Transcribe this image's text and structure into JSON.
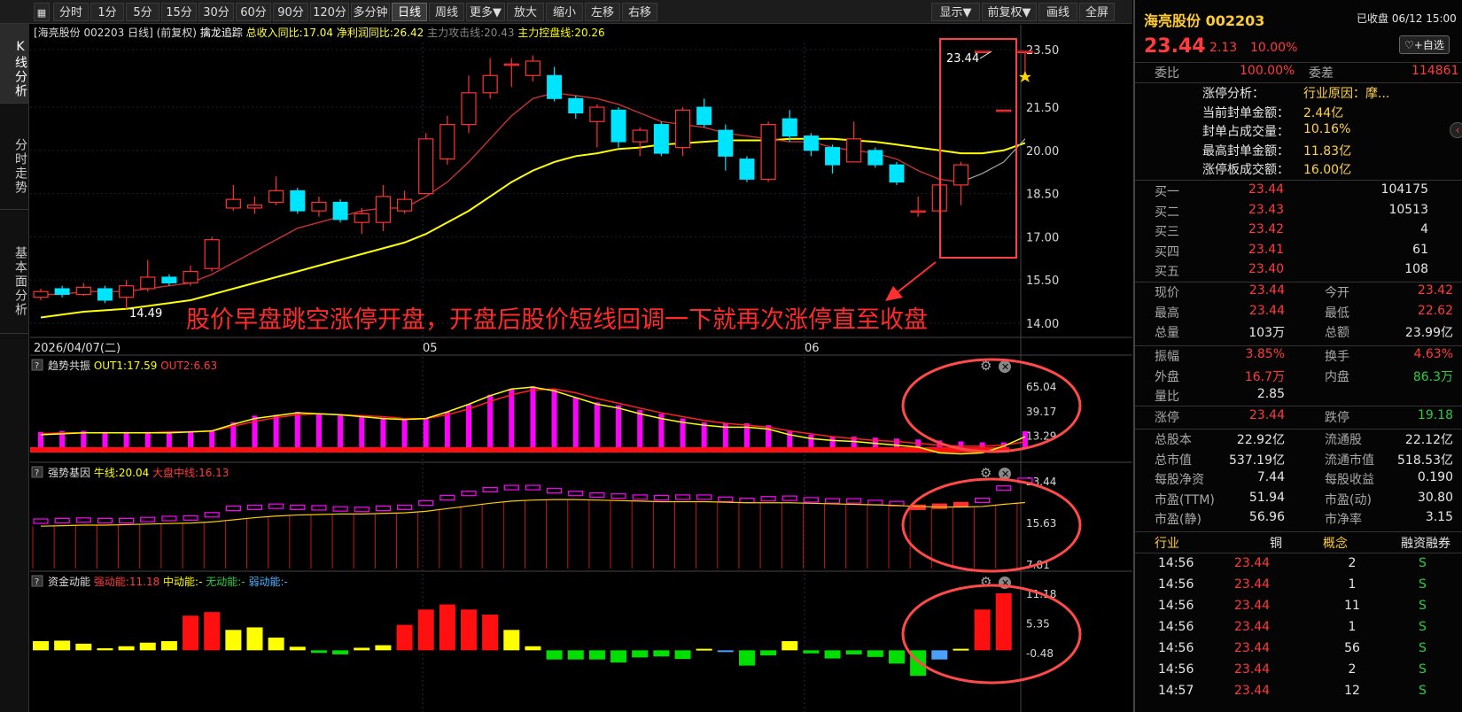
{
  "toolbar": {
    "items": [
      "分时",
      "1分",
      "5分",
      "15分",
      "30分",
      "60分",
      "90分",
      "120分",
      "多分钟",
      "日线",
      "周线",
      "更多▼",
      "放大",
      "缩小",
      "左移",
      "右移"
    ],
    "active": "日线",
    "right_items": [
      "显示▼",
      "前复权▼",
      "画线",
      "全屏"
    ]
  },
  "sidetabs": [
    "K线分析",
    "分时走势",
    "基本面分析"
  ],
  "main_header": {
    "title": "[海亮股份 002203 日线]",
    "adj": "(前复权)",
    "indicator_name": "擒龙追踪",
    "v1": "总收入同比:17.04",
    "v2": "净利润同比:26.42",
    "v3": "主力攻击线:20.43",
    "v4": "主力控盘线:20.26"
  },
  "main_axis": [
    "23.50",
    "21.50",
    "20.00",
    "18.50",
    "17.00",
    "15.50",
    "14.00"
  ],
  "price_label_high": "23.44",
  "price_label_low": "14.49",
  "annotation": "股价早盘跳空涨停开盘，开盘后股价短线回调一下就再次涨停直至收盘",
  "dates": [
    "2026/04/07(二)",
    "05",
    "06"
  ],
  "panel1": {
    "title": "趋势共振",
    "out1": "OUT1:17.59",
    "out2": "OUT2:6.63",
    "axis": [
      "65.04",
      "39.17",
      "13.29"
    ]
  },
  "panel2": {
    "title": "强势基因",
    "l1": "牛线:20.04",
    "l2": "大盘中线:16.13",
    "axis": [
      "23.44",
      "15.63",
      "7.81"
    ]
  },
  "panel3": {
    "title": "资金动能",
    "l1": "强动能:11.18",
    "l2": "中动能:-",
    "l3": "无动能:-",
    "l4": "弱动能:-",
    "axis": [
      "11.18",
      "5.35",
      "-0.48"
    ]
  },
  "colors": {
    "up": "#ff3232",
    "down": "#00e5ff",
    "ma_yellow": "#ffff00",
    "annotation": "#ff2a2a",
    "magenta": "#ff00ff"
  },
  "chart_data": {
    "type": "candlestick",
    "ylim": [
      14.0,
      23.5
    ],
    "candles": [
      {
        "o": 14.9,
        "c": 15.1,
        "h": 15.2,
        "l": 14.8
      },
      {
        "o": 15.2,
        "c": 15.0,
        "h": 15.3,
        "l": 14.9
      },
      {
        "o": 15.0,
        "c": 15.25,
        "h": 15.4,
        "l": 14.95
      },
      {
        "o": 15.2,
        "c": 14.8,
        "h": 15.3,
        "l": 14.7
      },
      {
        "o": 14.9,
        "c": 15.3,
        "h": 15.5,
        "l": 14.5
      },
      {
        "o": 15.2,
        "c": 15.6,
        "h": 16.2,
        "l": 15.1
      },
      {
        "o": 15.6,
        "c": 15.4,
        "h": 15.7,
        "l": 15.3
      },
      {
        "o": 15.4,
        "c": 15.8,
        "h": 16.0,
        "l": 15.3
      },
      {
        "o": 15.9,
        "c": 16.9,
        "h": 17.0,
        "l": 15.8
      },
      {
        "o": 18.0,
        "c": 18.3,
        "h": 18.8,
        "l": 17.9
      },
      {
        "o": 18.0,
        "c": 18.1,
        "h": 18.4,
        "l": 17.8
      },
      {
        "o": 18.2,
        "c": 18.6,
        "h": 19.1,
        "l": 18.1
      },
      {
        "o": 18.6,
        "c": 17.9,
        "h": 18.7,
        "l": 17.8
      },
      {
        "o": 17.9,
        "c": 18.2,
        "h": 18.4,
        "l": 17.7
      },
      {
        "o": 18.2,
        "c": 17.6,
        "h": 18.3,
        "l": 17.5
      },
      {
        "o": 17.5,
        "c": 17.8,
        "h": 18.0,
        "l": 17.1
      },
      {
        "o": 17.5,
        "c": 18.4,
        "h": 18.8,
        "l": 17.2
      },
      {
        "o": 17.9,
        "c": 18.3,
        "h": 18.6,
        "l": 17.8
      },
      {
        "o": 18.5,
        "c": 20.4,
        "h": 20.6,
        "l": 18.5
      },
      {
        "o": 19.7,
        "c": 20.9,
        "h": 21.2,
        "l": 19.5
      },
      {
        "o": 20.9,
        "c": 22.0,
        "h": 22.6,
        "l": 20.6
      },
      {
        "o": 22.0,
        "c": 22.6,
        "h": 23.2,
        "l": 21.8
      },
      {
        "o": 23.0,
        "c": 23.0,
        "h": 23.2,
        "l": 22.2
      },
      {
        "o": 22.6,
        "c": 23.1,
        "h": 23.3,
        "l": 22.4
      },
      {
        "o": 22.6,
        "c": 21.8,
        "h": 22.9,
        "l": 21.7
      },
      {
        "o": 21.8,
        "c": 21.3,
        "h": 21.9,
        "l": 21.1
      },
      {
        "o": 21.0,
        "c": 21.5,
        "h": 21.6,
        "l": 20.1
      },
      {
        "o": 21.4,
        "c": 20.3,
        "h": 21.5,
        "l": 20.1
      },
      {
        "o": 20.3,
        "c": 20.7,
        "h": 20.8,
        "l": 19.8
      },
      {
        "o": 20.9,
        "c": 19.9,
        "h": 21.0,
        "l": 19.8
      },
      {
        "o": 20.1,
        "c": 21.4,
        "h": 21.5,
        "l": 19.8
      },
      {
        "o": 21.5,
        "c": 20.9,
        "h": 21.8,
        "l": 20.8
      },
      {
        "o": 20.7,
        "c": 19.8,
        "h": 20.9,
        "l": 19.3
      },
      {
        "o": 19.7,
        "c": 19.0,
        "h": 19.8,
        "l": 18.9
      },
      {
        "o": 19.0,
        "c": 20.9,
        "h": 21.0,
        "l": 18.9
      },
      {
        "o": 21.1,
        "c": 20.5,
        "h": 21.4,
        "l": 20.3
      },
      {
        "o": 20.5,
        "c": 20.0,
        "h": 20.6,
        "l": 19.8
      },
      {
        "o": 20.1,
        "c": 19.5,
        "h": 20.2,
        "l": 19.2
      },
      {
        "o": 19.6,
        "c": 20.4,
        "h": 21.0,
        "l": 19.6
      },
      {
        "o": 20.0,
        "c": 19.5,
        "h": 20.1,
        "l": 19.4
      },
      {
        "o": 19.5,
        "c": 18.9,
        "h": 19.6,
        "l": 18.8
      },
      {
        "o": 17.9,
        "c": 17.9,
        "h": 18.4,
        "l": 17.7
      },
      {
        "o": 17.9,
        "c": 18.8,
        "h": 19.0,
        "l": 17.8
      },
      {
        "o": 18.8,
        "c": 19.5,
        "h": 19.6,
        "l": 18.1
      },
      {
        "o": 23.44,
        "c": 23.44,
        "h": 23.44,
        "l": 23.44
      },
      {
        "o": 21.4,
        "c": 21.4,
        "h": 21.4,
        "l": 21.4
      },
      {
        "o": 23.42,
        "c": 23.44,
        "h": 23.44,
        "l": 22.62
      }
    ],
    "ma_red": [
      15.0,
      15.0,
      15.1,
      15.1,
      15.1,
      15.2,
      15.3,
      15.4,
      15.7,
      16.1,
      16.5,
      16.9,
      17.3,
      17.5,
      17.7,
      17.9,
      18.0,
      18.0,
      18.4,
      18.9,
      19.6,
      20.4,
      21.2,
      21.8,
      22.0,
      21.9,
      21.8,
      21.6,
      21.3,
      21.0,
      20.9,
      20.8,
      20.6,
      20.5,
      20.4,
      20.3,
      20.3,
      20.1,
      20.0,
      19.9,
      19.7,
      19.3,
      19.0,
      18.9,
      19.2,
      19.6,
      20.4
    ],
    "ma_yellow": [
      14.2,
      14.3,
      14.4,
      14.45,
      14.5,
      14.6,
      14.7,
      14.8,
      15.0,
      15.2,
      15.4,
      15.6,
      15.8,
      16.0,
      16.2,
      16.4,
      16.6,
      16.8,
      17.1,
      17.5,
      17.9,
      18.4,
      18.9,
      19.3,
      19.6,
      19.8,
      19.9,
      20.05,
      20.1,
      20.2,
      20.25,
      20.3,
      20.35,
      20.35,
      20.35,
      20.4,
      20.4,
      20.4,
      20.35,
      20.3,
      20.2,
      20.1,
      20.0,
      19.9,
      19.9,
      20.0,
      20.26
    ],
    "p1_bars": [
      17,
      18,
      18,
      17,
      17,
      17,
      17,
      18,
      19,
      27,
      34,
      35,
      38,
      36,
      35,
      34,
      32,
      30,
      31,
      38,
      46,
      56,
      62,
      65,
      62,
      53,
      48,
      45,
      40,
      36,
      31,
      27,
      26,
      26,
      24,
      18,
      14,
      12,
      12,
      11,
      10,
      9,
      8,
      7,
      6,
      6,
      17.59
    ],
    "p1_yellow": [
      14,
      15,
      16,
      16,
      16,
      16,
      16,
      17,
      18,
      25,
      31,
      34,
      37,
      36,
      35,
      33,
      31,
      30,
      31,
      38,
      46,
      55,
      62,
      64,
      60,
      53,
      46,
      42,
      36,
      31,
      27,
      24,
      22,
      22,
      20,
      14,
      10,
      8,
      7,
      5,
      3,
      1,
      -5,
      -6,
      -5,
      2,
      12
    ],
    "p1_red": [
      15,
      16,
      16,
      16,
      16,
      16,
      17,
      17,
      18,
      23,
      28,
      32,
      35,
      36,
      35,
      34,
      33,
      31,
      31,
      35,
      41,
      49,
      56,
      61,
      62,
      58,
      52,
      47,
      42,
      37,
      33,
      29,
      26,
      24,
      22,
      18,
      15,
      12,
      10,
      8,
      7,
      5,
      3,
      2,
      2,
      3,
      6.63
    ],
    "p2_bars": [
      15.8,
      15.9,
      16.0,
      15.9,
      15.9,
      16.1,
      16.3,
      16.4,
      17.0,
      18.2,
      18.4,
      18.6,
      18.4,
      18.3,
      18.1,
      18.0,
      18.2,
      18.4,
      19.2,
      20.2,
      21.0,
      21.7,
      22.1,
      22.1,
      21.5,
      21.0,
      20.7,
      20.5,
      20.3,
      20.2,
      20.3,
      20.3,
      19.9,
      19.7,
      20.0,
      20.1,
      19.8,
      19.6,
      19.6,
      19.3,
      19.1,
      18.4,
      18.6,
      18.9,
      19.7,
      22.0,
      23.44
    ],
    "p2_yellow": [
      15.6,
      15.7,
      15.8,
      15.8,
      15.9,
      16.0,
      16.1,
      16.2,
      16.4,
      16.8,
      17.2,
      17.5,
      17.7,
      17.8,
      17.9,
      17.9,
      18.0,
      18.1,
      18.4,
      18.9,
      19.4,
      19.9,
      20.3,
      20.5,
      20.6,
      20.6,
      20.5,
      20.4,
      20.3,
      20.2,
      20.2,
      20.2,
      20.1,
      20.0,
      20.0,
      20.0,
      19.9,
      19.8,
      19.7,
      19.6,
      19.5,
      19.3,
      19.2,
      19.2,
      19.3,
      19.7,
      20.04
    ],
    "p3_bars": [
      1.8,
      1.9,
      1.3,
      0.4,
      0.8,
      1.5,
      1.8,
      6.8,
      7.5,
      4.0,
      4.5,
      2.5,
      0.7,
      -0.5,
      -0.8,
      0.5,
      1.0,
      5.0,
      8.0,
      9.0,
      8.0,
      7.0,
      4.0,
      0.8,
      -1.8,
      -1.8,
      -1.8,
      -2.4,
      -1.4,
      -1.2,
      -1.7,
      0.3,
      -0.3,
      -3.0,
      -1.0,
      1.8,
      -0.6,
      -1.6,
      -0.8,
      -1.3,
      -2.6,
      -5.0,
      -1.8,
      0.3,
      8.0,
      11.18
    ]
  },
  "right": {
    "name": "海亮股份 002203",
    "status": "已收盘 06/12 15:00",
    "price": "23.44",
    "chg": "2.13",
    "pct": "10.00%",
    "fav": "♡+自选",
    "weibi_l": "委比",
    "weibi_v": "100.00%",
    "weicha_l": "委差",
    "weicha_v": "114861",
    "limit_lines": [
      [
        "涨停分析：",
        "行业原因：摩..."
      ],
      [
        "当前封单金额：",
        "2.44亿"
      ],
      [
        "封单占成交量：",
        "10.16%"
      ],
      [
        "最高封单金额：",
        "11.83亿"
      ],
      [
        "涨停板成交额：",
        "16.00亿"
      ]
    ],
    "bids": [
      [
        "买一",
        "23.44",
        "104175"
      ],
      [
        "买二",
        "23.43",
        "10513"
      ],
      [
        "买三",
        "23.42",
        "4"
      ],
      [
        "买四",
        "23.41",
        "61"
      ],
      [
        "买五",
        "23.40",
        "108"
      ]
    ],
    "quote": [
      [
        "现价",
        "23.44",
        "今开",
        "23.42"
      ],
      [
        "最高",
        "23.44",
        "最低",
        "22.62"
      ],
      [
        "总量",
        "103万",
        "总额",
        "23.99亿"
      ]
    ],
    "quote2": [
      [
        "振幅",
        "3.85%",
        "换手",
        "4.63%"
      ],
      [
        "外盘",
        "16.7万",
        "内盘",
        "86.3万"
      ],
      [
        "量比",
        "2.85",
        "",
        ""
      ]
    ],
    "limits": [
      [
        "涨停",
        "23.44",
        "跌停",
        "19.18"
      ]
    ],
    "fund": [
      [
        "总股本",
        "22.92亿",
        "流通股",
        "22.12亿"
      ],
      [
        "总市值",
        "537.19亿",
        "流通市值",
        "518.53亿"
      ],
      [
        "每股净资",
        "7.44",
        "每股收益",
        "0.190"
      ],
      [
        "市盈(TTM)",
        "51.94",
        "市盈(动)",
        "30.80"
      ],
      [
        "市盈(静)",
        "56.96",
        "市净率",
        "3.15"
      ]
    ],
    "tabs": [
      "行业",
      "铜",
      "概念",
      "融资融券"
    ],
    "ticks": [
      [
        "14:56",
        "23.44",
        "2",
        "S"
      ],
      [
        "14:56",
        "23.44",
        "1",
        "S"
      ],
      [
        "14:56",
        "23.44",
        "11",
        "S"
      ],
      [
        "14:56",
        "23.44",
        "1",
        "S"
      ],
      [
        "14:56",
        "23.44",
        "56",
        "S"
      ],
      [
        "14:56",
        "23.44",
        "2",
        "S"
      ],
      [
        "14:57",
        "23.44",
        "12",
        "S"
      ]
    ]
  }
}
